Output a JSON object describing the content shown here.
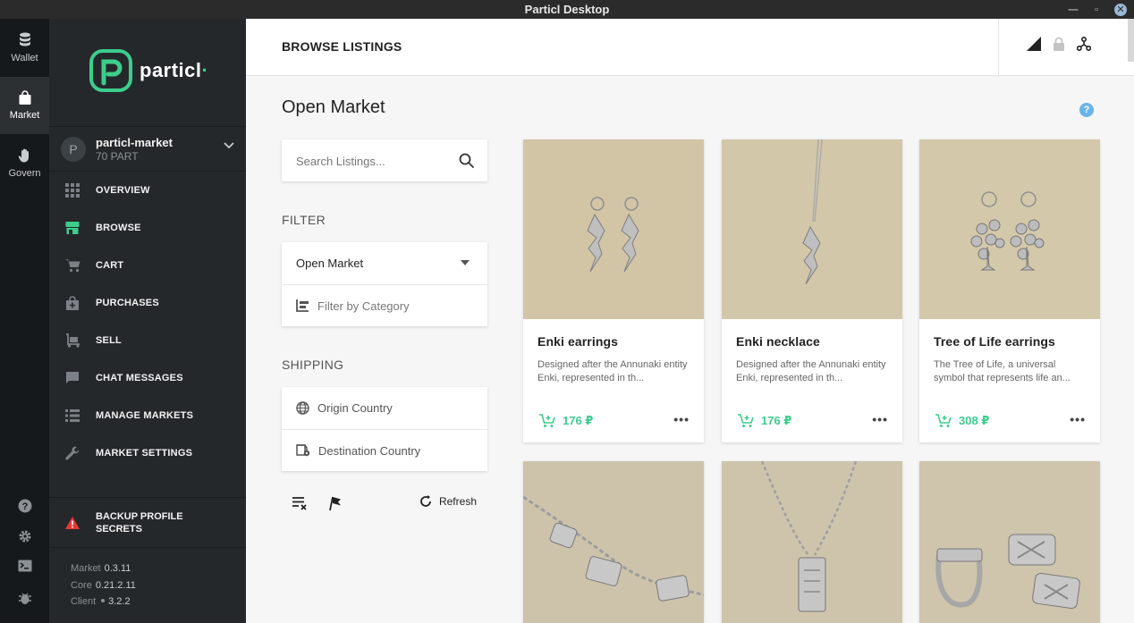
{
  "window": {
    "title": "Particl Desktop"
  },
  "rail": {
    "items": [
      {
        "label": "Wallet",
        "icon": "database-icon"
      },
      {
        "label": "Market",
        "icon": "shopping-bag-icon"
      },
      {
        "label": "Govern",
        "icon": "hand-icon"
      }
    ]
  },
  "sidebar": {
    "brand": "particl",
    "profile": {
      "initial": "P",
      "name": "particl-market",
      "balance": "70 PART"
    },
    "nav": [
      {
        "label": "OVERVIEW",
        "icon": "grid-icon"
      },
      {
        "label": "BROWSE",
        "icon": "storefront-icon"
      },
      {
        "label": "CART",
        "icon": "cart-icon"
      },
      {
        "label": "PURCHASES",
        "icon": "bag-add-icon"
      },
      {
        "label": "SELL",
        "icon": "trolley-icon"
      },
      {
        "label": "CHAT MESSAGES",
        "icon": "chat-icon"
      },
      {
        "label": "MANAGE MARKETS",
        "icon": "list-icon"
      },
      {
        "label": "MARKET SETTINGS",
        "icon": "wrench-icon"
      }
    ],
    "backup_line1": "BACKUP PROFILE",
    "backup_line2": "SECRETS",
    "versions": {
      "market_label": "Market",
      "market": "0.3.11",
      "core_label": "Core",
      "core": "0.21.2.11",
      "client_label": "Client",
      "client": "3.2.2"
    }
  },
  "header": {
    "title": "BROWSE LISTINGS"
  },
  "page": {
    "title": "Open Market",
    "help": "?"
  },
  "search": {
    "placeholder": "Search Listings..."
  },
  "filter": {
    "label": "FILTER",
    "market": "Open Market",
    "category_placeholder": "Filter by Category"
  },
  "shipping": {
    "label": "SHIPPING",
    "origin": "Origin Country",
    "destination": "Destination Country"
  },
  "tools": {
    "refresh": "Refresh"
  },
  "listings": [
    {
      "title": "Enki earrings",
      "desc": "Designed after the Annunaki entity Enki, represented in th...",
      "price": "176 ₽"
    },
    {
      "title": "Enki necklace",
      "desc": "Designed after the Annunaki entity Enki, represented in th...",
      "price": "176 ₽"
    },
    {
      "title": "Tree of Life earrings",
      "desc": "The Tree of Life, a universal symbol that represents life an...",
      "price": "308 ₽"
    },
    {
      "title": "",
      "desc": "",
      "price": ""
    },
    {
      "title": "",
      "desc": "",
      "price": ""
    },
    {
      "title": "",
      "desc": "",
      "price": ""
    }
  ],
  "colors": {
    "accent": "#3ccd8c",
    "sidebar": "#25282b",
    "rail": "#16191b",
    "warning": "#e53935"
  }
}
